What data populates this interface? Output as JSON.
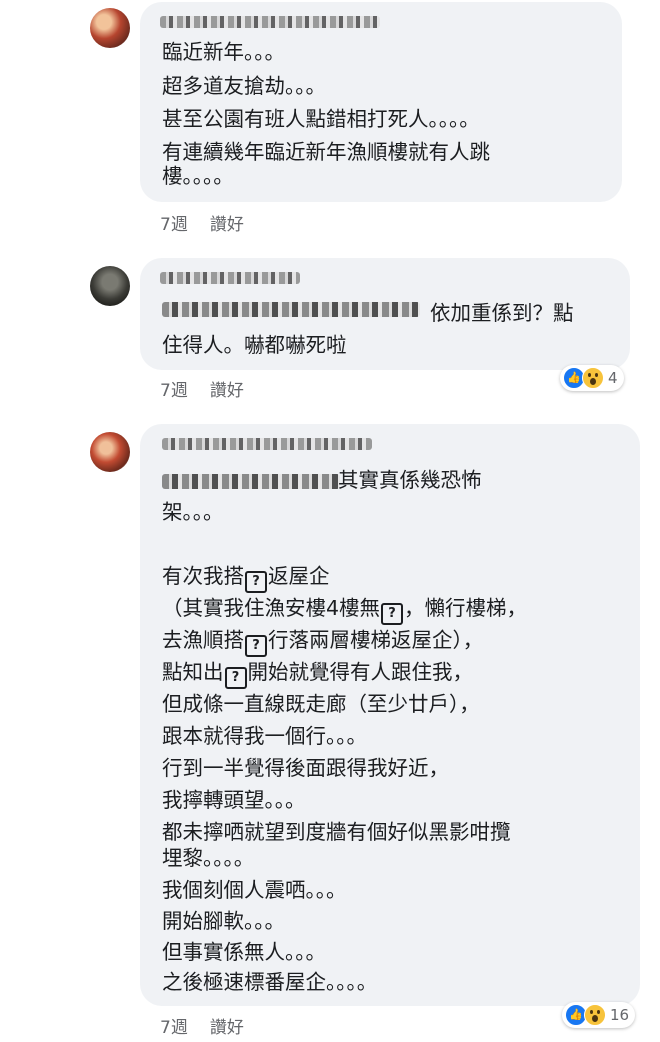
{
  "comments": [
    {
      "lines": [
        "臨近新年。。。",
        "超多道友搶劫。。。",
        "甚至公園有班人點錯相打死人。。。。",
        "有連續幾年臨近新年漁順樓就有人跳",
        "樓。。。。"
      ],
      "time": "7週",
      "like_label": "讚好"
    },
    {
      "lines": [
        "依加重係到？點",
        "住得人。嚇都嚇死啦"
      ],
      "time": "7週",
      "like_label": "讚好",
      "reaction_count": "4"
    },
    {
      "lines": [
        "其實真係幾恐怖",
        "架。。。",
        "有次我搭",
        "返屋企",
        "（其實我住漁安樓4樓無",
        "，懶行樓梯，",
        "去漁順搭",
        "行落兩層樓梯返屋企），",
        "點知出",
        "開始就覺得有人跟住我，",
        "但成條一直線既走廊（至少廿戶），",
        "跟本就得我一個行。。。",
        "行到一半覺得後面跟得我好近，",
        "我擰轉頭望。。。",
        "都未擰哂就望到度牆有個好似黑影咁攬",
        "埋黎。。。。",
        "我個刻個人震哂。。。",
        "開始腳軟。。。",
        "但事實係無人。。。",
        "之後極速標番屋企。。。。"
      ],
      "missing_glyph": "?",
      "time": "7週",
      "like_label": "讚好",
      "reaction_count": "16"
    }
  ],
  "icons": {
    "like": "thumbs-up-icon",
    "wow": "wow-face-icon"
  },
  "colors": {
    "bubble": "#f0f2f5",
    "like_blue": "#1877f2",
    "wow_yellow": "#f7c33b",
    "meta_gray": "#65676b"
  }
}
